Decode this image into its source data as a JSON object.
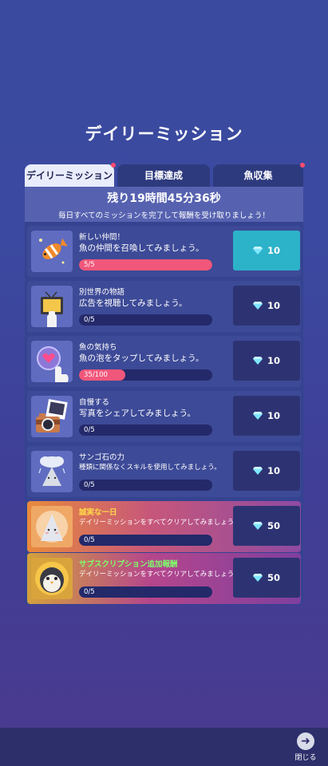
{
  "title": "デイリーミッション",
  "tabs": [
    {
      "label": "デイリーミッション",
      "active": true,
      "badge": true
    },
    {
      "label": "目標達成",
      "active": false,
      "badge": false
    },
    {
      "label": "魚収集",
      "active": false,
      "badge": true
    }
  ],
  "timer": {
    "remaining": "残り19時間45分36秒",
    "instruction": "毎日すべてのミッションを完了して報酬を受け取りましょう！"
  },
  "missions": [
    {
      "name": "新しい仲間！",
      "desc": "魚の仲間を召喚してみましょう。",
      "progress": "5/5",
      "progress_fraction": 1.0,
      "reward": "10",
      "claimable": true,
      "icon": "fish-summon-icon"
    },
    {
      "name": "別世界の物語",
      "desc": "広告を視聴してみましょう。",
      "progress": "0/5",
      "progress_fraction": 0.0,
      "reward": "10",
      "claimable": false,
      "icon": "tv-ad-icon"
    },
    {
      "name": "魚の気持ち",
      "desc": "魚の泡をタップしてみましょう。",
      "progress": "35/100",
      "progress_fraction": 0.35,
      "reward": "10",
      "claimable": false,
      "icon": "bubble-tap-icon"
    },
    {
      "name": "自慢する",
      "desc": "写真をシェアしてみましょう。",
      "progress": "0/5",
      "progress_fraction": 0.0,
      "reward": "10",
      "claimable": false,
      "icon": "camera-share-icon"
    },
    {
      "name": "サンゴ石の力",
      "desc": "種類に関係なくスキルを使用してみましょう。",
      "progress": "0/5",
      "progress_fraction": 0.0,
      "reward": "10",
      "claimable": false,
      "icon": "coral-stone-icon"
    },
    {
      "name": "誠実な一日",
      "desc": "デイリーミッションをすべてクリアしてみましょう。",
      "progress": "0/5",
      "progress_fraction": 0.0,
      "reward": "50",
      "claimable": false,
      "icon": "daily-complete-icon"
    },
    {
      "name": "サブスクリプション追加報酬",
      "desc": "デイリーミッションをすべてクリアしてみましょう。",
      "progress": "0/5",
      "progress_fraction": 0.0,
      "reward": "50",
      "claimable": false,
      "icon": "subscription-penguin-icon"
    }
  ],
  "close_label": "閉じる",
  "colors": {
    "accent": "#2cb2c9",
    "progress": "#f0577a",
    "gold": "#ffd94a",
    "green": "#7dff6a"
  }
}
